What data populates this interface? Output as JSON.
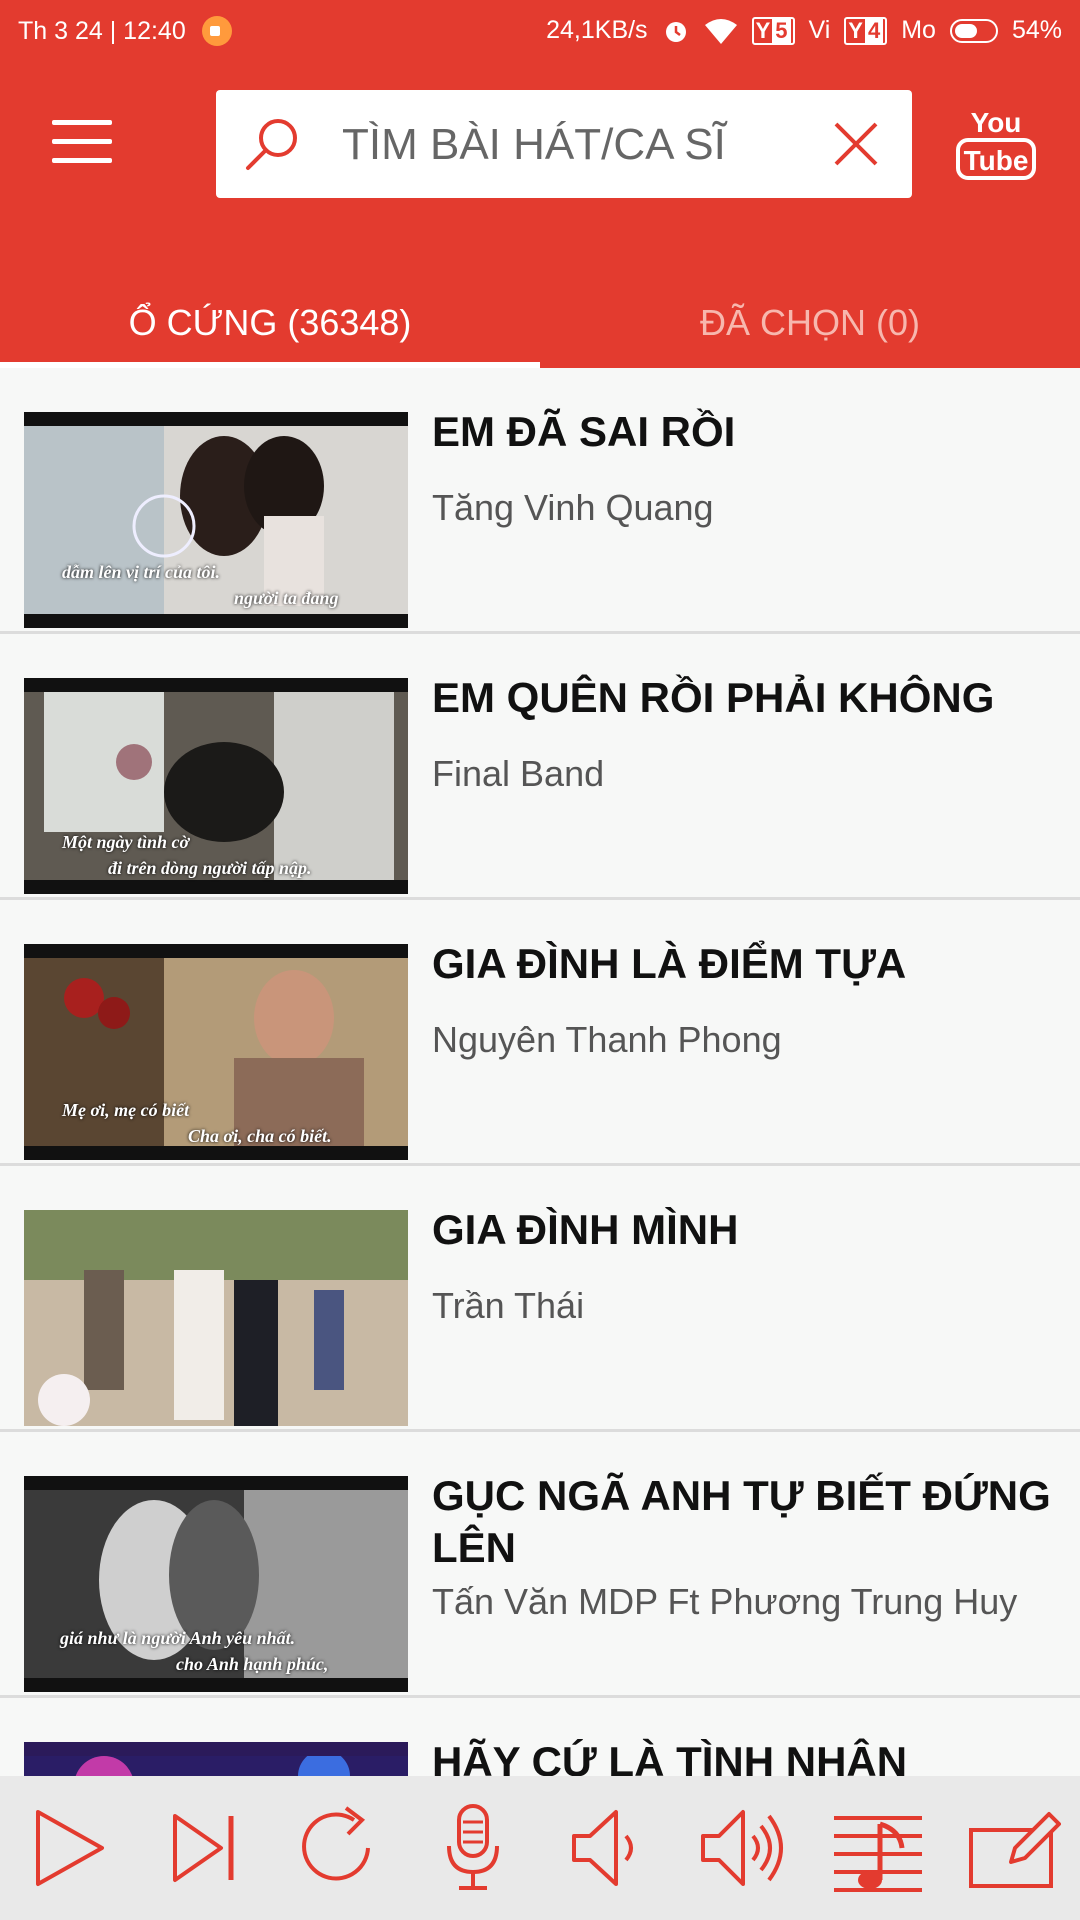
{
  "status_bar": {
    "datetime": "Th 3 24 | 12:40",
    "network_speed": "24,1KB/s",
    "sim1_label": "5",
    "sim1_carrier": "Vi",
    "sim2_label": "4",
    "sim2_carrier": "Mo",
    "battery": "54%"
  },
  "header": {
    "search_placeholder": "TÌM BÀI HÁT/CA SĨ",
    "youtube_line1": "You",
    "youtube_line2": "Tube"
  },
  "tabs": [
    {
      "label": "Ổ CỨNG (36348)",
      "active": true
    },
    {
      "label": "ĐÃ CHỌN (0)",
      "active": false
    }
  ],
  "songs": [
    {
      "title": "EM ĐÃ SAI RỒI",
      "artist": "Tăng Vinh Quang",
      "lyric1": "dẫm lên vị trí của tôi.",
      "lyric2": "người ta đang"
    },
    {
      "title": "EM QUÊN RỒI PHẢI KHÔNG",
      "artist": "Final Band",
      "lyric1": "Một ngày tình cờ",
      "lyric2": "đi trên dòng người tấp nập."
    },
    {
      "title": "GIA ĐÌNH LÀ ĐIỂM TỰA",
      "artist": "Nguyên Thanh Phong",
      "lyric1": "Mẹ ơi, mẹ có biết",
      "lyric2": "Cha ơi, cha có biết."
    },
    {
      "title": "GIA ĐÌNH MÌNH",
      "artist": "Trần Thái",
      "lyric1": "",
      "lyric2": ""
    },
    {
      "title": "GỤC NGÃ ANH TỰ BIẾT ĐỨNG LÊN",
      "artist": "Tấn Văn MDP Ft Phương Trung Huy",
      "lyric1": "giá như là người Anh yêu nhất.",
      "lyric2": "cho Anh hạnh phúc,"
    },
    {
      "title": "HÃY CỨ LÀ TÌNH NHÂN",
      "artist": "",
      "lyric1": "",
      "lyric2": ""
    }
  ],
  "toolbar_icons": [
    "play-icon",
    "skip-next-icon",
    "replay-icon",
    "microphone-icon",
    "volume-down-icon",
    "volume-up-icon",
    "music-score-icon",
    "edit-icon"
  ],
  "colors": {
    "primary": "#e33b2f",
    "toolbar_bg": "#e9e9e9"
  }
}
